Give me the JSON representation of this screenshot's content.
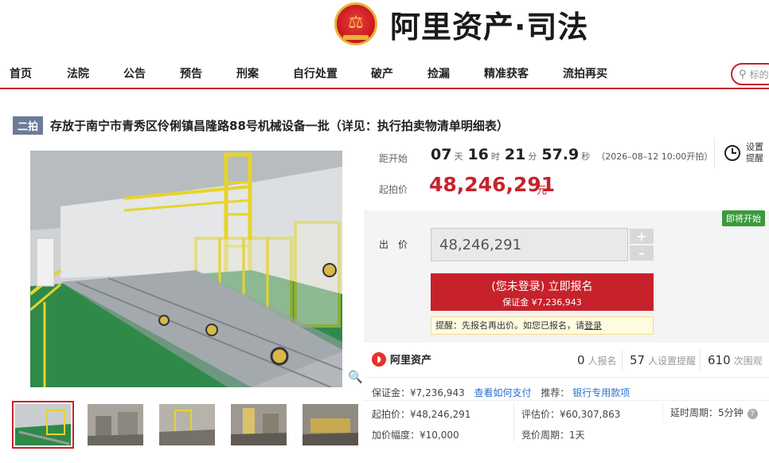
{
  "logo": {
    "text": "阿里资产·司法"
  },
  "nav": {
    "items": [
      {
        "label": "首页"
      },
      {
        "label": "法院"
      },
      {
        "label": "公告"
      },
      {
        "label": "预告"
      },
      {
        "label": "刑案"
      },
      {
        "label": "自行处置"
      },
      {
        "label": "破产"
      },
      {
        "label": "捡漏"
      },
      {
        "label": "精准获客"
      },
      {
        "label": "流拍再买"
      }
    ],
    "search_placeholder": "标的"
  },
  "title": {
    "round": "二拍",
    "text": "存放于南宁市青秀区伶俐镇昌隆路88号机械设备一批（详见：执行拍卖物清单明细表）"
  },
  "countdown": {
    "label": "距开始",
    "days": "07",
    "days_unit": "天",
    "hours": "16",
    "hours_unit": "时",
    "minutes": "21",
    "minutes_unit": "分",
    "seconds": "57.9",
    "seconds_unit": "秒",
    "start_note": "（2026–08–12 10:00开拍）"
  },
  "start_price": {
    "label": "起拍价",
    "value": "48,246,291",
    "unit": "元"
  },
  "remind": {
    "line1": "设置",
    "line2": "提醒"
  },
  "bid": {
    "status_tag": "即将开始",
    "label": "出　价",
    "value": "48,246,291",
    "plus": "+",
    "minus": "–",
    "signup_line1": "(您未登录) 立即报名",
    "signup_line2": "保证金 ¥7,236,943",
    "tip_text": "提醒：先报名再出价。如您已报名，请",
    "tip_link": "登录"
  },
  "stats": {
    "brand": "阿里资产",
    "registered": "0",
    "registered_label": "人报名",
    "reminders": "57",
    "reminders_label": "人设置提醒",
    "views": "610",
    "views_label": "次围观"
  },
  "details": {
    "deposit": "保证金：¥7,236,943",
    "how_to_pay": "查看如何支付",
    "recommend_label": "推荐：",
    "recommend_link": "银行专用款项",
    "start_price": "起拍价：¥48,246,291",
    "appraisal": "评估价：¥60,307,863",
    "delay": "延时周期：5分钟",
    "increment": "加价幅度：¥10,000",
    "cycle": "竞价周期：1天"
  },
  "colors": {
    "brand_red": "#c7222b",
    "green_tag": "#3a9a3a",
    "link_blue": "#2a6fcf"
  }
}
